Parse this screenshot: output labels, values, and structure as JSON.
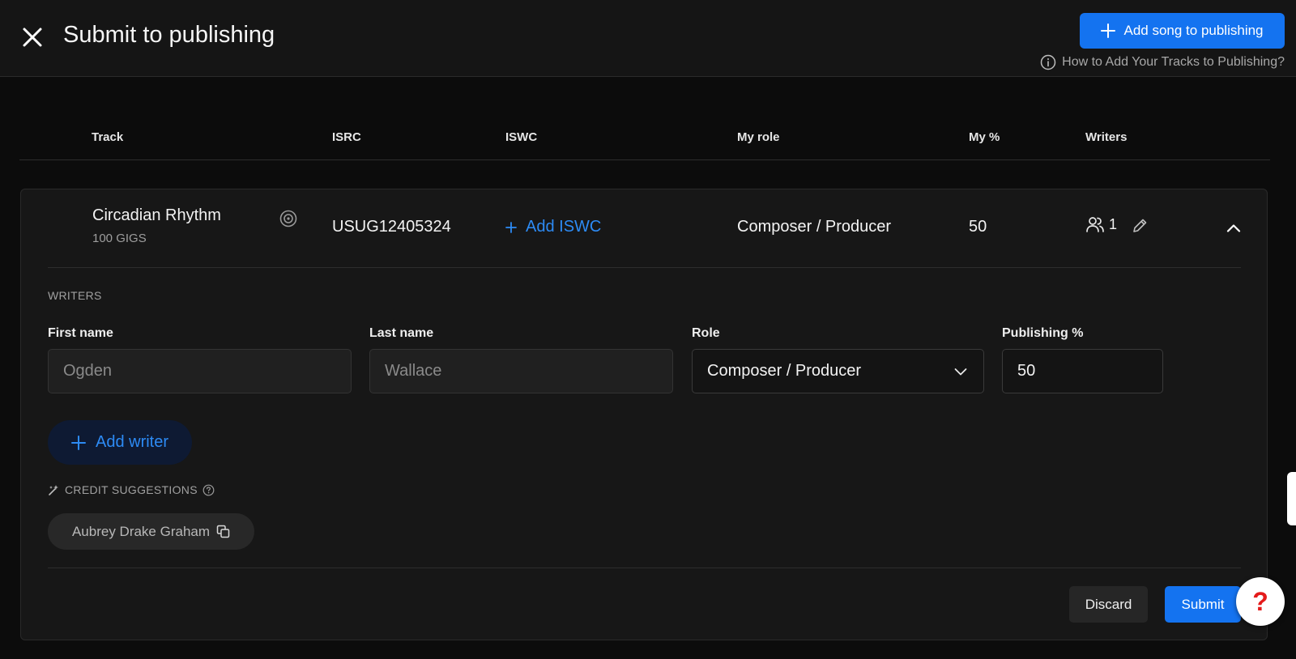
{
  "header": {
    "title": "Submit to publishing",
    "add_song_label": "Add song to publishing",
    "help_link_label": "How to Add Your Tracks to Publishing?"
  },
  "table": {
    "columns": [
      "Track",
      "ISRC",
      "ISWC",
      "My role",
      "My %",
      "Writers"
    ]
  },
  "row": {
    "track_title": "Circadian Rhythm",
    "artist": "100 GIGS",
    "isrc": "USUG12405324",
    "add_iswc_label": "Add ISWC",
    "my_role": "Composer / Producer",
    "my_percent": "50",
    "writers_count": "1"
  },
  "writers_section": {
    "heading": "WRITERS",
    "labels": {
      "first_name": "First name",
      "last_name": "Last name",
      "role": "Role",
      "publishing_pct": "Publishing %"
    },
    "writer": {
      "first_name": "Ogden",
      "last_name": "Wallace",
      "role": "Composer / Producer",
      "publishing_pct": "50"
    },
    "add_writer_label": "Add writer"
  },
  "credit_suggestions": {
    "heading": "CREDIT SUGGESTIONS",
    "items": [
      "Aubrey Drake Graham"
    ]
  },
  "actions": {
    "discard_label": "Discard",
    "submit_label": "Submit"
  },
  "help_fab": {
    "label": "?"
  },
  "colors": {
    "accent": "#1473f0",
    "link": "#2d8bf5",
    "background": "#0c0c0c",
    "card": "#171717"
  },
  "icons": [
    "close-icon",
    "plus-icon",
    "info-icon",
    "disc-icon",
    "users-icon",
    "pencil-icon",
    "chevron-up-icon",
    "chevron-down-icon",
    "sparkle-icon",
    "help-circle-icon",
    "copy-icon"
  ]
}
